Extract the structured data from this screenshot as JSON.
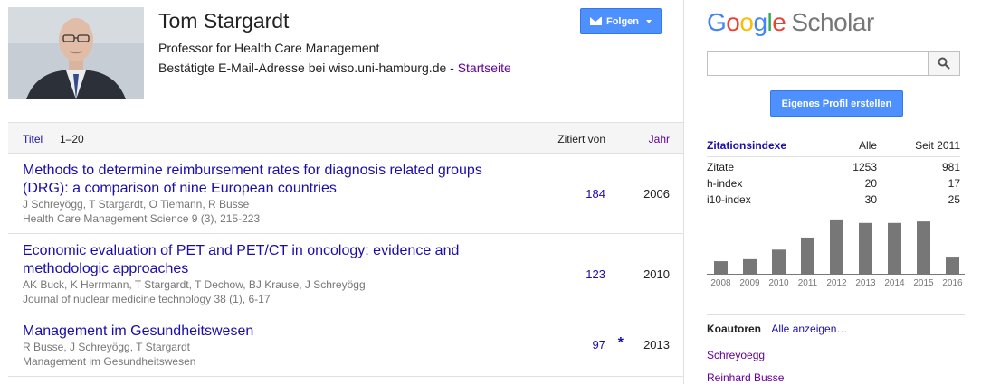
{
  "profile": {
    "name": "Tom Stargardt",
    "affiliation": "Professor for Health Care Management",
    "email_text": "Bestätigte E-Mail-Adresse bei wiso.uni-hamburg.de - ",
    "homepage_label": "Startseite",
    "follow_label": "Folgen"
  },
  "table": {
    "header": {
      "title": "Titel",
      "range": "1–20",
      "cited_by": "Zitiert von",
      "year": "Jahr"
    },
    "rows": [
      {
        "title": "Methods to determine reimbursement rates for diagnosis related groups (DRG): a comparison of nine European countries",
        "authors": "J Schreyögg, T Stargardt, O Tiemann, R Busse",
        "venue": "Health Care Management Science 9 (3), 215-223",
        "cites": "184",
        "year": "2006"
      },
      {
        "title": "Economic evaluation of PET and PET/CT in oncology: evidence and methodologic approaches",
        "authors": "AK Buck, K Herrmann, T Stargardt, T Dechow, BJ Krause, J Schreyögg",
        "venue": "Journal of nuclear medicine technology 38 (1), 6-17",
        "cites": "123",
        "year": "2010"
      },
      {
        "title": "Management im Gesundheitswesen",
        "authors": "R Busse, J Schreyögg, T Stargardt",
        "venue": "Management im Gesundheitswesen",
        "cites": "97",
        "star": "*",
        "year": "2013"
      }
    ]
  },
  "sidebar": {
    "logo_google": [
      "G",
      "o",
      "o",
      "g",
      "l",
      "e"
    ],
    "logo_scholar": "Scholar",
    "create_profile_label": "Eigenes Profil erstellen",
    "citations": {
      "header": {
        "label": "Zitationsindexe",
        "all": "Alle",
        "since": "Seit 2011"
      },
      "rows": [
        {
          "label": "Zitate",
          "all": "1253",
          "since": "981"
        },
        {
          "label": "h-index",
          "all": "20",
          "since": "17"
        },
        {
          "label": "i10-index",
          "all": "30",
          "since": "25"
        }
      ]
    },
    "coauthors": {
      "title": "Koautoren",
      "show_all": "Alle anzeigen…",
      "items": [
        "Schreyoegg",
        "Reinhard Busse"
      ]
    }
  },
  "chart_data": {
    "type": "bar",
    "categories": [
      "2008",
      "2009",
      "2010",
      "2011",
      "2012",
      "2013",
      "2014",
      "2015",
      "2016"
    ],
    "values": [
      25,
      29,
      48,
      72,
      108,
      101,
      101,
      104,
      34
    ],
    "ylim": [
      0,
      115
    ],
    "color": "#777777"
  }
}
